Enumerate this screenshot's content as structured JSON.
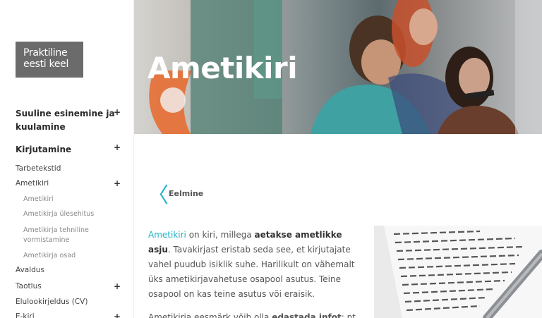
{
  "logo": {
    "line1": "Praktiline",
    "line2": "eesti keel"
  },
  "nav": [
    {
      "label": "Suuline esinemine ja kuulamine",
      "plus": "+"
    },
    {
      "label": "Kirjutamine",
      "plus": "+"
    },
    {
      "label": "Tarbetekstid"
    },
    {
      "label": "Ametikiri",
      "plus": "+"
    },
    {
      "label": "Ametikiri"
    },
    {
      "label": "Ametikirja ülesehitus"
    },
    {
      "label": "Ametikirja tehniline vormistamine"
    },
    {
      "label": "Ametikirja osad"
    },
    {
      "label": "Avaldus"
    },
    {
      "label": "Taotlus",
      "plus": "+"
    },
    {
      "label": "Elulookirjeldus (CV)"
    },
    {
      "label": "E-kiri",
      "plus": "+"
    }
  ],
  "hero": {
    "title": "Ametikiri"
  },
  "prev": {
    "chevron": "〈",
    "label": "Eelmine"
  },
  "content": {
    "p1_link": "Ametikiri",
    "p1_a": " on kiri, millega ",
    "p1_bold": "aetakse ametlikke asju",
    "p1_b": ". Tavakirjast eristab seda see, et kirjutajate vahel puudub isiklik suhe. Harilikult on vähemalt üks ametikirjavahetuse osapool asutus. Teine osapool on kas teine asutus või eraisik.",
    "p2_a": "Ametikirja eesmärk võib olla ",
    "p2_bold": "edastada infot",
    "p2_b": ": nt"
  },
  "colors": {
    "accent": "#1fb3c4",
    "logo_bg": "#6b6b6b"
  }
}
